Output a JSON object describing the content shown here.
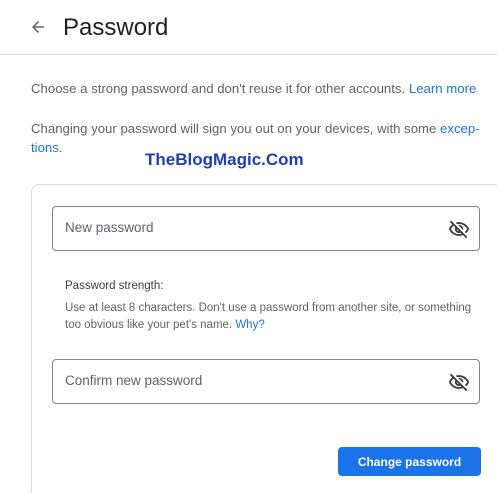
{
  "header": {
    "title": "Password"
  },
  "intro": {
    "text": "Choose a strong password and don't reuse it for other accounts.",
    "learn_more": "Learn more"
  },
  "signout_note": {
    "text": "Changing your password will sign you out on your devices, with some ",
    "link": "excep-tions",
    "end": "."
  },
  "watermark": "TheBlogMagic.Com",
  "form": {
    "new_password": {
      "placeholder": "New password",
      "icon": "visibility-off-icon"
    },
    "strength": {
      "label": "Password strength:",
      "help": "Use at least 8 characters. Don't use a password from another site, or something too obvious like your pet's name.",
      "why": "Why?"
    },
    "confirm_password": {
      "placeholder": "Confirm new password",
      "icon": "visibility-off-icon"
    },
    "submit_label": "Change password"
  },
  "colors": {
    "accent": "#1a73e8",
    "watermark": "#1e3fae",
    "text_secondary": "#5f6368"
  }
}
